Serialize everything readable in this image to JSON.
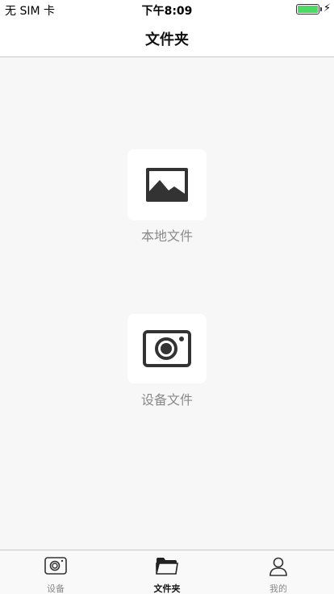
{
  "status_bar": {
    "carrier": "无 SIM 卡",
    "time": "下午8:09",
    "battery_level": 1.0,
    "battery_color": "#4cd964",
    "charging_icon": "bolt-icon"
  },
  "nav": {
    "title": "文件夹"
  },
  "content": {
    "local_files": {
      "label": "本地文件",
      "icon": "image-icon"
    },
    "device_files": {
      "label": "设备文件",
      "icon": "camera-icon"
    }
  },
  "tab_bar": {
    "active_index": 1,
    "tabs": [
      {
        "label": "设备",
        "icon": "camera-icon"
      },
      {
        "label": "文件夹",
        "icon": "folder-icon"
      },
      {
        "label": "我的",
        "icon": "person-icon"
      }
    ]
  }
}
